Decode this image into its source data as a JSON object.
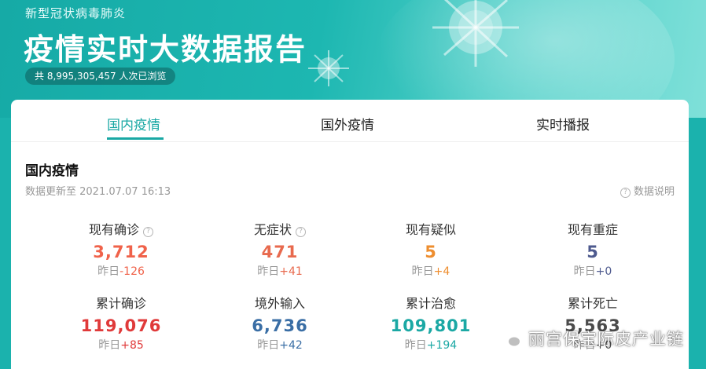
{
  "banner": {
    "subtitle": "新型冠状病毒肺炎",
    "title": "疫情实时大数据报告",
    "views": "共 8,995,305,457 人次已浏览"
  },
  "tabs": [
    {
      "label": "国内疫情",
      "active": true
    },
    {
      "label": "国外疫情",
      "active": false
    },
    {
      "label": "实时播报",
      "active": false
    }
  ],
  "section": {
    "title": "国内疫情",
    "update_time": "数据更新至 2021.07.07 16:13",
    "explain": "数据说明"
  },
  "colors": {
    "accent": "#19a8a4",
    "red_light": "#f0624a",
    "orange": "#ee8e2f",
    "navy": "#4e5a8e",
    "red": "#e03a3a",
    "blue": "#3a6ea5",
    "teal": "#1ba8a4",
    "dark": "#4b4b4b"
  },
  "stats": [
    {
      "label": "现有确诊",
      "value": "3,712",
      "delta_prefix": "昨日",
      "delta": "-126",
      "value_color": "#f0624a",
      "delta_color": "#f0624a",
      "help": true
    },
    {
      "label": "无症状",
      "value": "471",
      "delta_prefix": "昨日",
      "delta": "+41",
      "value_color": "#e86a4e",
      "delta_color": "#e86a4e",
      "help": true
    },
    {
      "label": "现有疑似",
      "value": "5",
      "delta_prefix": "昨日",
      "delta": "+4",
      "value_color": "#ee8e2f",
      "delta_color": "#ee8e2f",
      "help": false
    },
    {
      "label": "现有重症",
      "value": "5",
      "delta_prefix": "昨日",
      "delta": "+0",
      "value_color": "#4e5a8e",
      "delta_color": "#4e5a8e",
      "help": false
    },
    {
      "label": "累计确诊",
      "value": "119,076",
      "delta_prefix": "昨日",
      "delta": "+85",
      "value_color": "#e03a3a",
      "delta_color": "#e03a3a",
      "help": false
    },
    {
      "label": "境外输入",
      "value": "6,736",
      "delta_prefix": "昨日",
      "delta": "+42",
      "value_color": "#3a6ea5",
      "delta_color": "#3a6ea5",
      "help": false
    },
    {
      "label": "累计治愈",
      "value": "109,801",
      "delta_prefix": "昨日",
      "delta": "+194",
      "value_color": "#1ba8a4",
      "delta_color": "#1ba8a4",
      "help": false
    },
    {
      "label": "累计死亡",
      "value": "5,563",
      "delta_prefix": "昨日",
      "delta": "+0",
      "value_color": "#4b4b4b",
      "delta_color": "#4b4b4b",
      "help": false
    }
  ],
  "watermark": {
    "icon": "wechat-icon",
    "text": "丽宫保宝际皮产业链"
  }
}
